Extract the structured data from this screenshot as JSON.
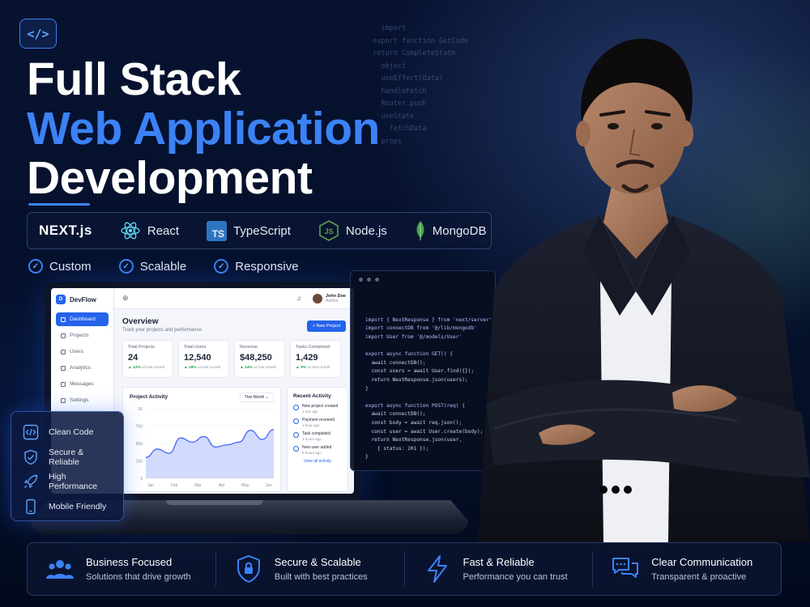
{
  "header": {
    "logo_glyph": "</>",
    "title_line1": "Full Stack",
    "title_line2": "Web Application",
    "title_line3": "Development",
    "accent_color": "#3b82f6"
  },
  "tech_stack": [
    {
      "label": "NEXT.js",
      "icon": "nextjs-icon"
    },
    {
      "label": "React",
      "icon": "react-icon"
    },
    {
      "label": "TypeScript",
      "icon": "typescript-icon",
      "badge": "TS"
    },
    {
      "label": "Node.js",
      "icon": "nodejs-icon",
      "badge": "JS"
    },
    {
      "label": "MongoDB",
      "icon": "mongodb-leaf-icon"
    }
  ],
  "features": [
    "Custom",
    "Scalable",
    "Responsive"
  ],
  "dashboard": {
    "brand": "DevFlow",
    "nav": [
      "Dashboard",
      "Projects",
      "Users",
      "Analytics",
      "Messages",
      "Settings"
    ],
    "user_name": "John Doe",
    "user_role": "Admin",
    "overview_title": "Overview",
    "overview_sub": "Track your projects and performance",
    "new_project": "+ New Project",
    "stats": [
      {
        "label": "Total Projects",
        "value": "24",
        "change": "▲ 12%",
        "period": "vs last month"
      },
      {
        "label": "Total Users",
        "value": "12,540",
        "change": "▲ 18%",
        "period": "vs last month"
      },
      {
        "label": "Revenue",
        "value": "$48,250",
        "change": "▲ 14%",
        "period": "vs last month"
      },
      {
        "label": "Tasks Completed",
        "value": "1,429",
        "change": "▲ 9%",
        "period": "vs last month"
      }
    ],
    "activity_title": "Project Activity",
    "activity_range": "This Month",
    "chart_data": {
      "type": "area",
      "categories": [
        "Jan",
        "Feb",
        "Mar",
        "Apr",
        "May",
        "Jun"
      ],
      "y_ticks": [
        "1K",
        "750",
        "500",
        "250",
        "0"
      ],
      "ylim": [
        0,
        1000
      ],
      "values": [
        300,
        420,
        360,
        580,
        520,
        600,
        450,
        480,
        520,
        690,
        560,
        700
      ]
    },
    "recent_title": "Recent Activity",
    "recent": [
      {
        "title": "New project created",
        "time": "2 min ago"
      },
      {
        "title": "Payment received",
        "time": "1 hour ago"
      },
      {
        "title": "Task completed",
        "time": "3 hours ago"
      },
      {
        "title": "New user added",
        "time": "5 hours ago"
      }
    ],
    "recent_link": "View all activity"
  },
  "code_window": {
    "lines": [
      "import { NextResponse } from 'next/server'",
      "import connectDB from '@/lib/mongodb'",
      "import User from '@/models/User'",
      "",
      "export async function GET() {",
      "  await connectDB();",
      "  const users = await User.find({});",
      "  return NextResponse.json(users);",
      "}",
      "",
      "export async function POST(req) {",
      "  await connectDB();",
      "  const body = await req.json();",
      "  const user = await User.create(body);",
      "  return NextResponse.json(user,",
      "    { status: 201 });",
      "}"
    ]
  },
  "benefit_panel": [
    {
      "label": "Clean Code",
      "icon": "code-icon"
    },
    {
      "label": "Secure & Reliable",
      "icon": "shield-check-icon"
    },
    {
      "label": "High Performance",
      "icon": "rocket-icon"
    },
    {
      "label": "Mobile Friendly",
      "icon": "mobile-icon"
    }
  ],
  "bottom_bar": [
    {
      "title": "Business Focused",
      "sub": "Solutions that drive growth",
      "icon": "team-icon"
    },
    {
      "title": "Secure & Scalable",
      "sub": "Built with best practices",
      "icon": "lock-shield-icon"
    },
    {
      "title": "Fast & Reliable",
      "sub": "Performance you can trust",
      "icon": "lightning-icon"
    },
    {
      "title": "Clear Communication",
      "sub": "Transparent & proactive",
      "icon": "chat-bubbles-icon"
    }
  ]
}
